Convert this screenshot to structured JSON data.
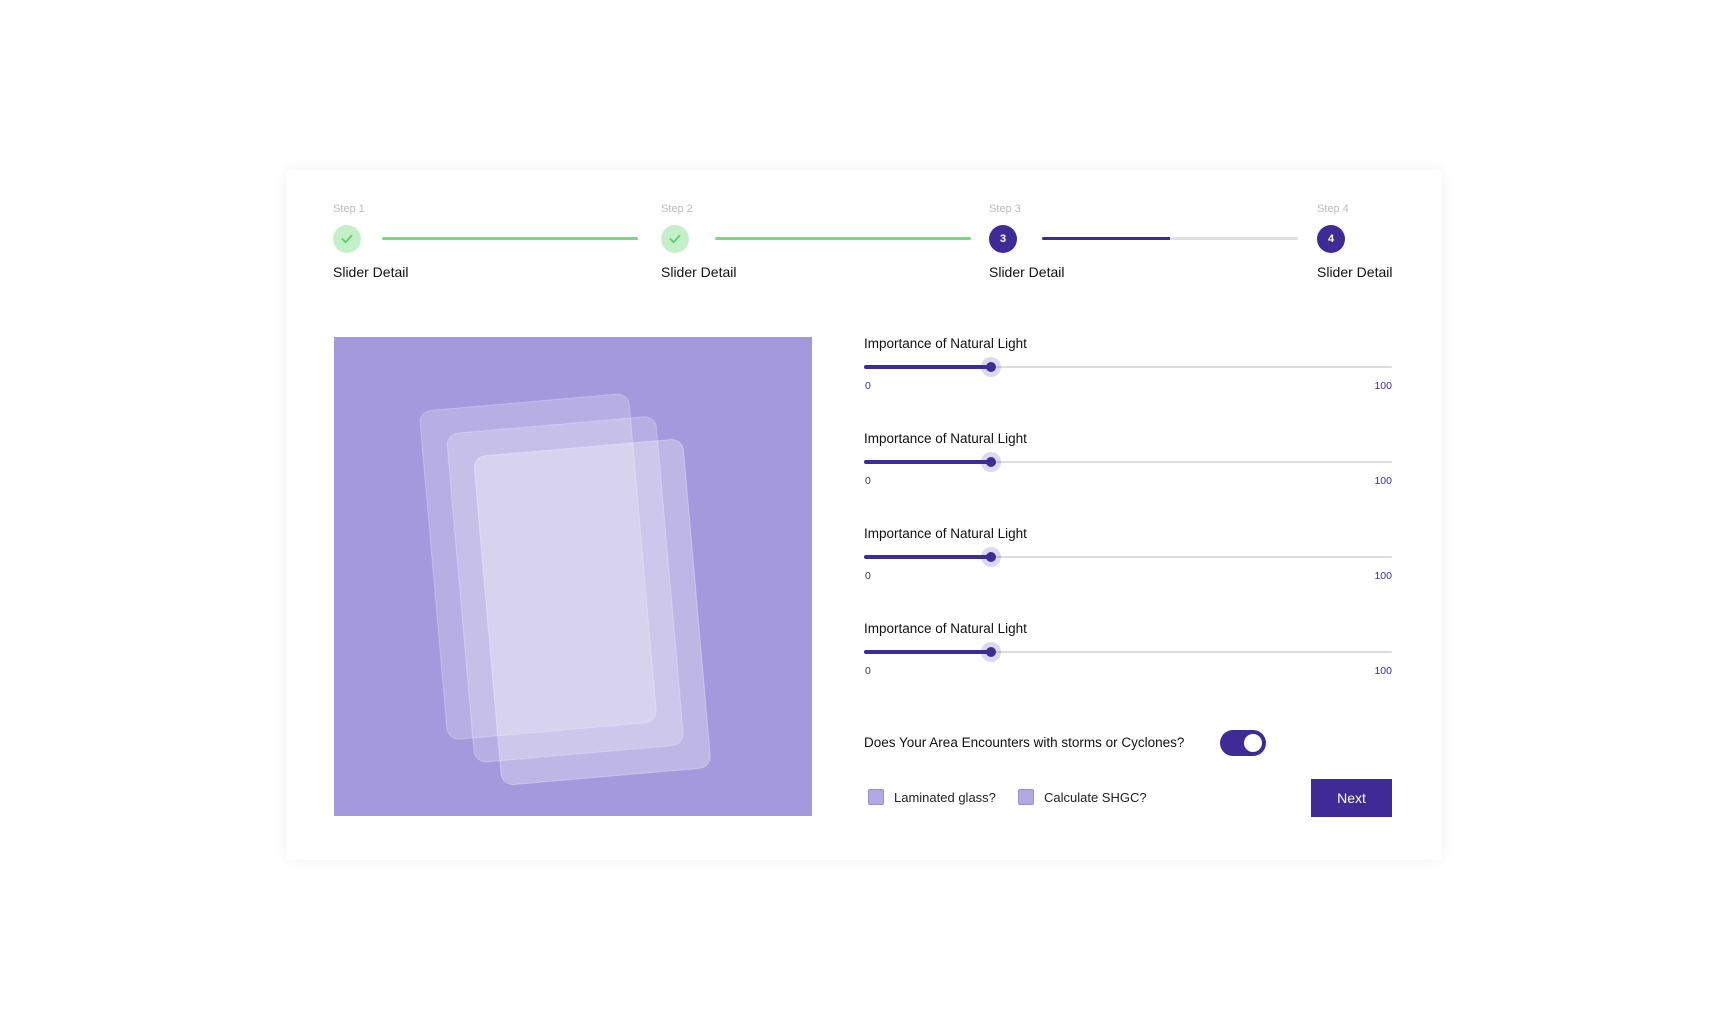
{
  "colors": {
    "primary": "#3f2b96",
    "done": "#c3f0c8",
    "done_line": "#79d97f",
    "preview_bg": "#a399dc"
  },
  "steps": [
    {
      "caption": "Step 1",
      "title": "Slider Detail",
      "state": "done",
      "icon": "check-icon"
    },
    {
      "caption": "Step 2",
      "title": "Slider Detail",
      "state": "done",
      "icon": "check-icon"
    },
    {
      "caption": "Step 3",
      "title": "Slider Detail",
      "state": "active",
      "number": "3"
    },
    {
      "caption": "Step 4",
      "title": "Slider Detail",
      "state": "active",
      "number": "4"
    }
  ],
  "connectors": [
    1.0,
    1.0,
    0.5
  ],
  "sliders": [
    {
      "label": "Importance of Natural Light",
      "min": "0",
      "max": "100",
      "value": 24
    },
    {
      "label": "Importance of Natural Light",
      "min": "0",
      "max": "100",
      "value": 24
    },
    {
      "label": "Importance of Natural Light",
      "min": "0",
      "max": "100",
      "value": 24
    },
    {
      "label": "Importance of Natural Light",
      "min": "0",
      "max": "100",
      "value": 24
    }
  ],
  "storm_question": "Does Your Area Encounters with storms or Cyclones?",
  "storm_toggle_on": true,
  "checkboxes": {
    "laminated": "Laminated glass?",
    "shgc": "Calculate SHGC?"
  },
  "next_label": "Next"
}
